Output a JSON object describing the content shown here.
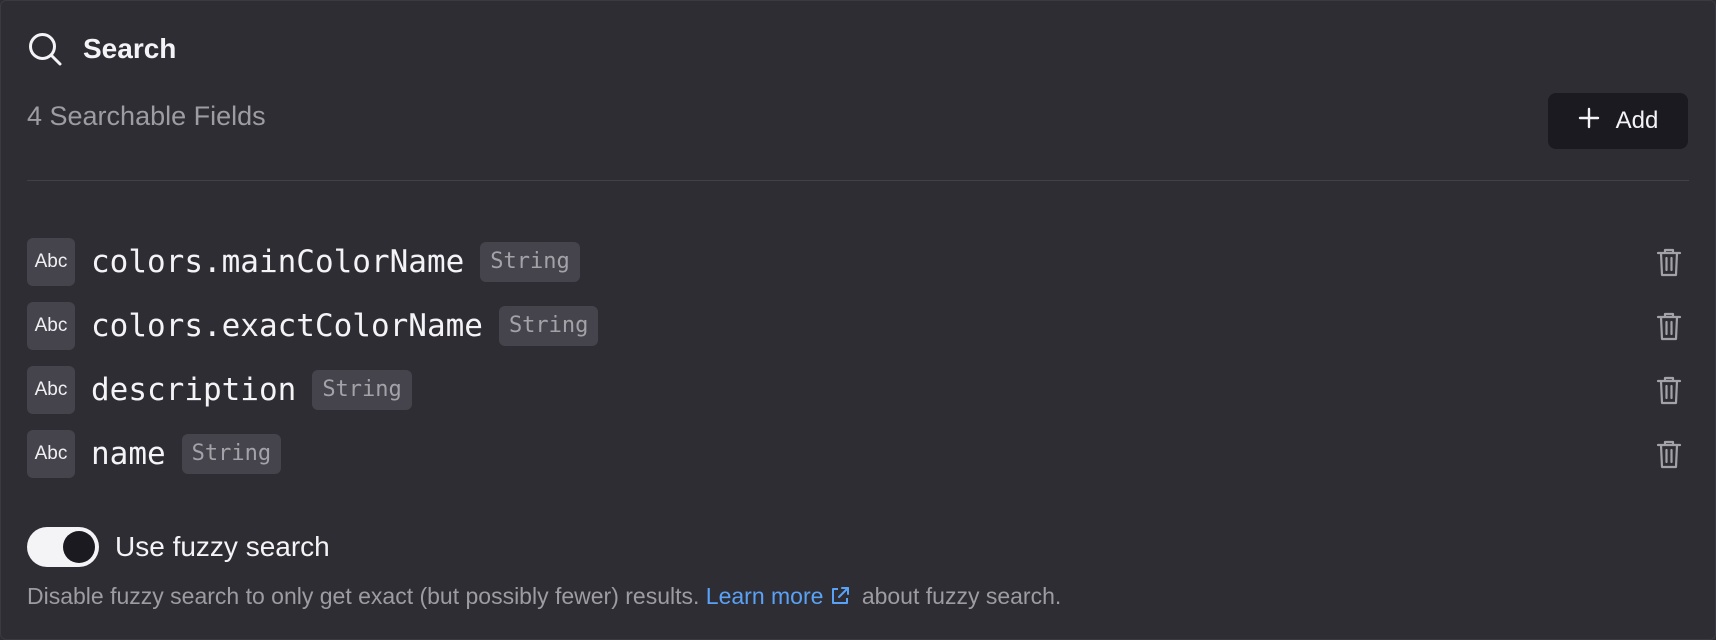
{
  "header": {
    "title": "Search",
    "icon": "search-icon"
  },
  "fields_summary": {
    "count_label": "4 Searchable Fields"
  },
  "add_button": {
    "label": "Add",
    "icon": "plus-icon"
  },
  "fields": [
    {
      "type_badge": "Abc",
      "name": "colors.mainColorName",
      "type": "String"
    },
    {
      "type_badge": "Abc",
      "name": "colors.exactColorName",
      "type": "String"
    },
    {
      "type_badge": "Abc",
      "name": "description",
      "type": "String"
    },
    {
      "type_badge": "Abc",
      "name": "name",
      "type": "String"
    }
  ],
  "fuzzy": {
    "label": "Use fuzzy search",
    "enabled": true,
    "help_before": "Disable fuzzy search to only get exact (but possibly fewer) results.",
    "link_text": "Learn more",
    "help_after": "about fuzzy search."
  },
  "colors": {
    "background": "#2e2d34",
    "link": "#5aa2f5",
    "button_bg": "#1b1a20",
    "badge_bg": "#45444c"
  }
}
